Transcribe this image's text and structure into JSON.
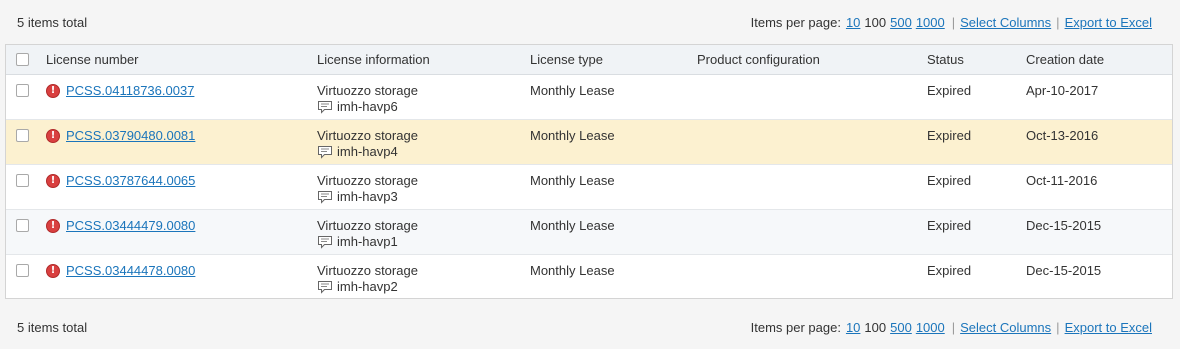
{
  "top_bar": {
    "total": "5 items total",
    "per_page_label": "Items per page:",
    "per_page_options": [
      "10",
      "100",
      "500",
      "1000"
    ],
    "per_page_current": "100",
    "select_columns": "Select Columns",
    "export": "Export to Excel",
    "separator": "|"
  },
  "bottom_bar": {
    "total": "5 items total",
    "per_page_label": "Items per page:",
    "per_page_options": [
      "10",
      "100",
      "500",
      "1000"
    ],
    "select_columns": "Select Columns",
    "export": "Export to Excel",
    "separator": "|"
  },
  "columns": {
    "license_number": "License number",
    "license_information": "License information",
    "license_type": "License type",
    "product_configuration": "Product configuration",
    "status": "Status",
    "creation_date": "Creation date"
  },
  "rows": [
    {
      "number": "PCSS.04118736.0037",
      "info_product": "Virtuozzo storage",
      "info_note": "imh-havp6",
      "type": "Monthly Lease",
      "product_configuration": "",
      "status": "Expired",
      "date": "Apr-10-2017",
      "status_icon": "error-icon",
      "highlighted": false
    },
    {
      "number": "PCSS.03790480.0081",
      "info_product": "Virtuozzo storage",
      "info_note": "imh-havp4",
      "type": "Monthly Lease",
      "product_configuration": "",
      "status": "Expired",
      "date": "Oct-13-2016",
      "status_icon": "error-icon",
      "highlighted": true
    },
    {
      "number": "PCSS.03787644.0065",
      "info_product": "Virtuozzo storage",
      "info_note": "imh-havp3",
      "type": "Monthly Lease",
      "product_configuration": "",
      "status": "Expired",
      "date": "Oct-11-2016",
      "status_icon": "error-icon",
      "highlighted": false
    },
    {
      "number": "PCSS.03444479.0080",
      "info_product": "Virtuozzo storage",
      "info_note": "imh-havp1",
      "type": "Monthly Lease",
      "product_configuration": "",
      "status": "Expired",
      "date": "Dec-15-2015",
      "status_icon": "error-icon",
      "highlighted": false
    },
    {
      "number": "PCSS.03444478.0080",
      "info_product": "Virtuozzo storage",
      "info_note": "imh-havp2",
      "type": "Monthly Lease",
      "product_configuration": "",
      "status": "Expired",
      "date": "Dec-15-2015",
      "status_icon": "error-icon",
      "highlighted": false
    }
  ],
  "colors": {
    "link": "#1b75bb",
    "highlight_row": "#fcf1d0",
    "error": "#d94040",
    "header_bg": "#f0f3f6"
  }
}
